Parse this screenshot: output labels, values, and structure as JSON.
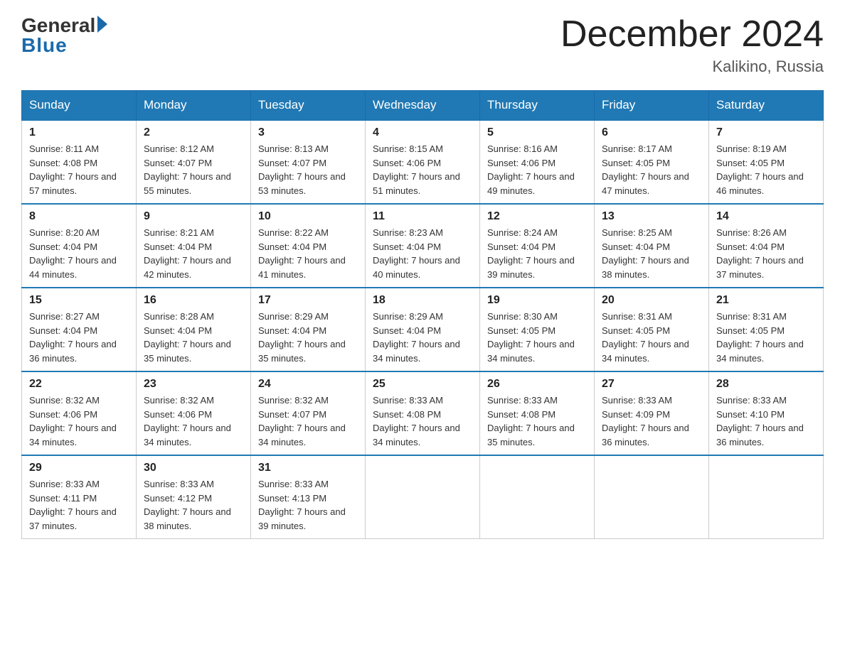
{
  "logo": {
    "general": "General",
    "blue": "Blue"
  },
  "title": "December 2024",
  "subtitle": "Kalikino, Russia",
  "days_header": [
    "Sunday",
    "Monday",
    "Tuesday",
    "Wednesday",
    "Thursday",
    "Friday",
    "Saturday"
  ],
  "weeks": [
    [
      {
        "day": "1",
        "sunrise": "8:11 AM",
        "sunset": "4:08 PM",
        "daylight": "7 hours and 57 minutes."
      },
      {
        "day": "2",
        "sunrise": "8:12 AM",
        "sunset": "4:07 PM",
        "daylight": "7 hours and 55 minutes."
      },
      {
        "day": "3",
        "sunrise": "8:13 AM",
        "sunset": "4:07 PM",
        "daylight": "7 hours and 53 minutes."
      },
      {
        "day": "4",
        "sunrise": "8:15 AM",
        "sunset": "4:06 PM",
        "daylight": "7 hours and 51 minutes."
      },
      {
        "day": "5",
        "sunrise": "8:16 AM",
        "sunset": "4:06 PM",
        "daylight": "7 hours and 49 minutes."
      },
      {
        "day": "6",
        "sunrise": "8:17 AM",
        "sunset": "4:05 PM",
        "daylight": "7 hours and 47 minutes."
      },
      {
        "day": "7",
        "sunrise": "8:19 AM",
        "sunset": "4:05 PM",
        "daylight": "7 hours and 46 minutes."
      }
    ],
    [
      {
        "day": "8",
        "sunrise": "8:20 AM",
        "sunset": "4:04 PM",
        "daylight": "7 hours and 44 minutes."
      },
      {
        "day": "9",
        "sunrise": "8:21 AM",
        "sunset": "4:04 PM",
        "daylight": "7 hours and 42 minutes."
      },
      {
        "day": "10",
        "sunrise": "8:22 AM",
        "sunset": "4:04 PM",
        "daylight": "7 hours and 41 minutes."
      },
      {
        "day": "11",
        "sunrise": "8:23 AM",
        "sunset": "4:04 PM",
        "daylight": "7 hours and 40 minutes."
      },
      {
        "day": "12",
        "sunrise": "8:24 AM",
        "sunset": "4:04 PM",
        "daylight": "7 hours and 39 minutes."
      },
      {
        "day": "13",
        "sunrise": "8:25 AM",
        "sunset": "4:04 PM",
        "daylight": "7 hours and 38 minutes."
      },
      {
        "day": "14",
        "sunrise": "8:26 AM",
        "sunset": "4:04 PM",
        "daylight": "7 hours and 37 minutes."
      }
    ],
    [
      {
        "day": "15",
        "sunrise": "8:27 AM",
        "sunset": "4:04 PM",
        "daylight": "7 hours and 36 minutes."
      },
      {
        "day": "16",
        "sunrise": "8:28 AM",
        "sunset": "4:04 PM",
        "daylight": "7 hours and 35 minutes."
      },
      {
        "day": "17",
        "sunrise": "8:29 AM",
        "sunset": "4:04 PM",
        "daylight": "7 hours and 35 minutes."
      },
      {
        "day": "18",
        "sunrise": "8:29 AM",
        "sunset": "4:04 PM",
        "daylight": "7 hours and 34 minutes."
      },
      {
        "day": "19",
        "sunrise": "8:30 AM",
        "sunset": "4:05 PM",
        "daylight": "7 hours and 34 minutes."
      },
      {
        "day": "20",
        "sunrise": "8:31 AM",
        "sunset": "4:05 PM",
        "daylight": "7 hours and 34 minutes."
      },
      {
        "day": "21",
        "sunrise": "8:31 AM",
        "sunset": "4:05 PM",
        "daylight": "7 hours and 34 minutes."
      }
    ],
    [
      {
        "day": "22",
        "sunrise": "8:32 AM",
        "sunset": "4:06 PM",
        "daylight": "7 hours and 34 minutes."
      },
      {
        "day": "23",
        "sunrise": "8:32 AM",
        "sunset": "4:06 PM",
        "daylight": "7 hours and 34 minutes."
      },
      {
        "day": "24",
        "sunrise": "8:32 AM",
        "sunset": "4:07 PM",
        "daylight": "7 hours and 34 minutes."
      },
      {
        "day": "25",
        "sunrise": "8:33 AM",
        "sunset": "4:08 PM",
        "daylight": "7 hours and 34 minutes."
      },
      {
        "day": "26",
        "sunrise": "8:33 AM",
        "sunset": "4:08 PM",
        "daylight": "7 hours and 35 minutes."
      },
      {
        "day": "27",
        "sunrise": "8:33 AM",
        "sunset": "4:09 PM",
        "daylight": "7 hours and 36 minutes."
      },
      {
        "day": "28",
        "sunrise": "8:33 AM",
        "sunset": "4:10 PM",
        "daylight": "7 hours and 36 minutes."
      }
    ],
    [
      {
        "day": "29",
        "sunrise": "8:33 AM",
        "sunset": "4:11 PM",
        "daylight": "7 hours and 37 minutes."
      },
      {
        "day": "30",
        "sunrise": "8:33 AM",
        "sunset": "4:12 PM",
        "daylight": "7 hours and 38 minutes."
      },
      {
        "day": "31",
        "sunrise": "8:33 AM",
        "sunset": "4:13 PM",
        "daylight": "7 hours and 39 minutes."
      },
      null,
      null,
      null,
      null
    ]
  ]
}
